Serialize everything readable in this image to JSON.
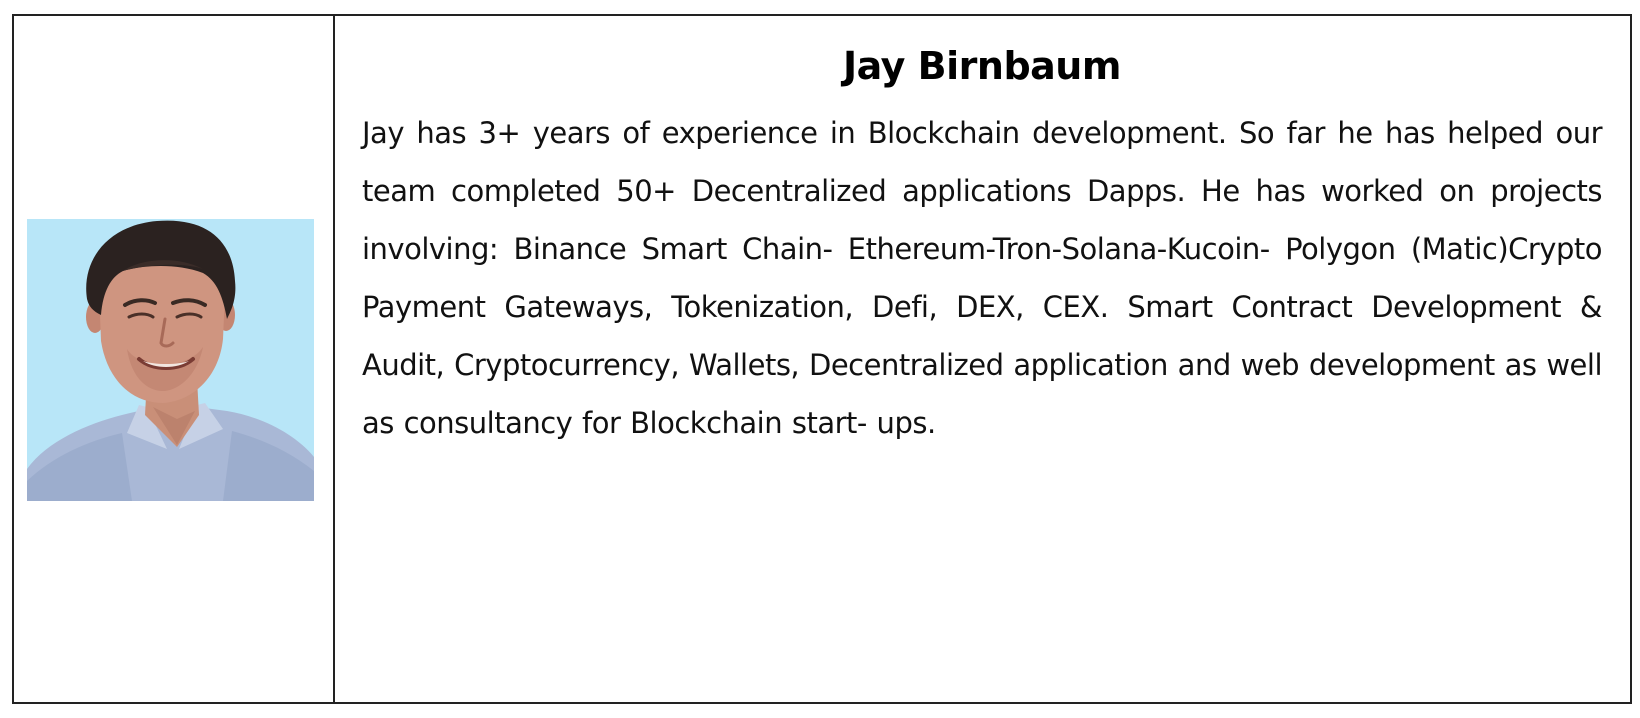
{
  "profile": {
    "name": "Jay Birnbaum",
    "bio": "Jay has 3+ years of experience in Blockchain development. So far he has helped our team completed 50+ Decentralized applications Dapps. He has worked on projects involving: Binance Smart Chain- Ethereum-Tron-Solana-Kucoin- Polygon (Matic)Crypto Payment Gateways, Tokenization, Defi, DEX, CEX. Smart Contract Development & Audit, Cryptocurrency, Wallets, Decentralized application and web development as well as consultancy for Blockchain start- ups.",
    "photo_background_color": "#b8e6f8"
  }
}
